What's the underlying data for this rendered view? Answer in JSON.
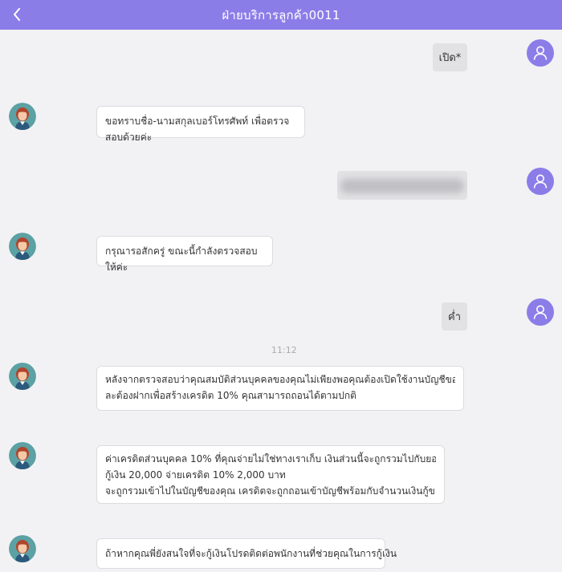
{
  "header": {
    "title": "ฝ่ายบริการลูกค้า0011"
  },
  "messages": {
    "out1": "เปิด*",
    "in1": "ขอทราบชื่อ-นามสกุลเบอร์โทรศัพท์ เพื่อตรวจสอบด้วยค่ะ",
    "in2": "กรุณารอสักครู่ ขณะนี้กำลังตรวจสอบให้ค่ะ",
    "out3": "ค่ำ",
    "time": "11:12",
    "in3_line1": "หลังจากตรวจสอบว่าคุณสมบัติส่วนบุคคลของคุณไม่เพียงพอคุณต้องเปิดใช้งานบัญชีของคุณแ",
    "in3_line2": "ละต้องฝากเพื่อสร้างเครดิต 10% คุณสามารถถอนได้ตามปกติ",
    "in4_line1": "ค่าเครดิตส่วนบุคคล 10% ที่คุณจ่ายไม่ใช่ทางเราเก็บ เงินส่วนนี้จะถูกรวมไปกับยอดเงินกู้",
    "in4_line2": "กู้เงิน 20,000 จ่ายเครดิต 10% 2,000 บาท",
    "in4_line3": "จะถูกรวมเข้าไปในบัญชีของคุณ เครดิตจะถูกถอนเข้าบัญชีพร้อมกับจำนวนเงินกู้ของคุณ",
    "in5": "ถ้าหากคุณพี่ยังสนใจที่จะกู้เงินโปรดติดต่อพนักงานที่ช่วยคุณในการกู้เงิน"
  },
  "icons": {
    "back": "chevron-left-icon",
    "user_avatar": "user-icon",
    "agent_avatar": "agent-avatar"
  },
  "colors": {
    "header": "#8b7de8",
    "user_avatar": "#8b7de8",
    "outgoing_bubble": "#e2e2e4",
    "incoming_bubble": "#ffffff",
    "background": "#f2f2f4"
  }
}
